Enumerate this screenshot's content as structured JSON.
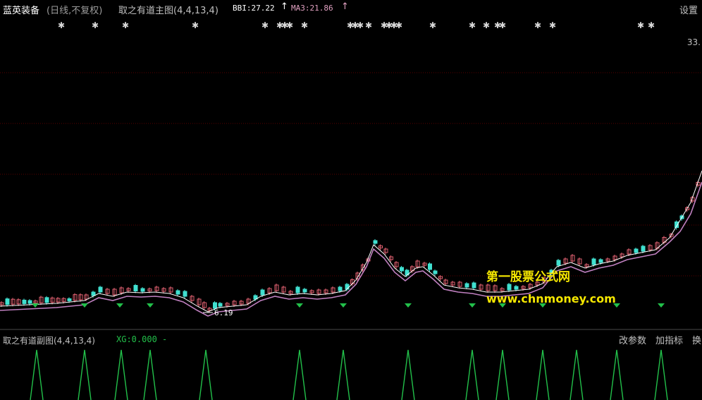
{
  "header": {
    "stock_name": "蓝英装备",
    "period": "(日线,不复权)",
    "indicator_name": "取之有道主图(4,4,13,4)",
    "bbi_text": "BBI:27.22",
    "bbi_arrow": "↑",
    "ma3_text": "MA3:21.86",
    "ma3_arrow": "↑",
    "settings_label": "设置"
  },
  "price_axis": {
    "top_label": "33.",
    "low_annotation": "6.19"
  },
  "sub_panel": {
    "indicator_name": "取之有道副图(4,4,13,4)",
    "xg_text": "XG:0.000 -",
    "buttons": [
      "改参数",
      "加指标",
      "换"
    ]
  },
  "watermark": {
    "line1": "第一股票公式网",
    "line2": "www.chnmoney.com"
  },
  "colors": {
    "background": "#000000",
    "grid": "#5a0000",
    "up_candle": "#e06070",
    "down_candle": "#40e0d0",
    "bbi_line": "#ffffff",
    "ma_line": "#c080c0",
    "signal_triangle": "#22c04a",
    "spike": "#22c04a",
    "watermark": "#f5e700"
  }
}
